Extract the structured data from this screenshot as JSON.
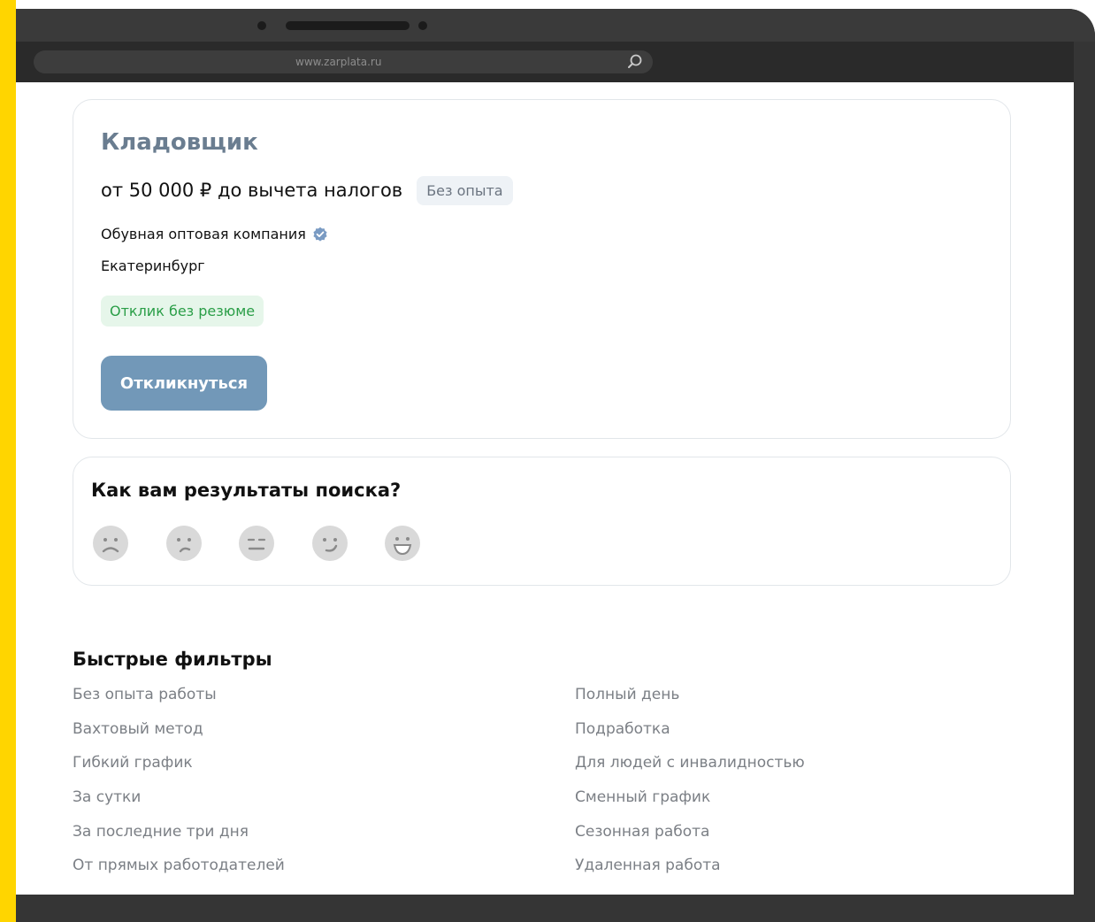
{
  "browser": {
    "url": "www.zarplata.ru",
    "search_icon": "search-icon"
  },
  "vacancy": {
    "title": "Кладовщик",
    "salary": "от 50 000 ₽ до вычета налогов",
    "experience_badge": "Без опыта",
    "company": "Обувная оптовая компания",
    "verified_icon": "verified-check-icon",
    "city": "Екатеринбург",
    "no_resume_badge": "Отклик без резюме",
    "respond_button": "Откликнуться",
    "accent_color": "#7298b8"
  },
  "feedback": {
    "title": "Как вам результаты поиска?",
    "faces": [
      "very-sad-face-icon",
      "sad-face-icon",
      "neutral-face-icon",
      "happy-face-icon",
      "very-happy-face-icon"
    ]
  },
  "quick_filters": {
    "title": "Быстрые фильтры",
    "left": [
      "Без опыта работы",
      "Вахтовый метод",
      "Гибкий график",
      "За сутки",
      "За последние три дня",
      "От прямых работодателей"
    ],
    "right": [
      "Полный день",
      "Подработка",
      "Для людей с инвалидностью",
      "Сменный график",
      "Сезонная работа",
      "Удаленная работа"
    ]
  }
}
